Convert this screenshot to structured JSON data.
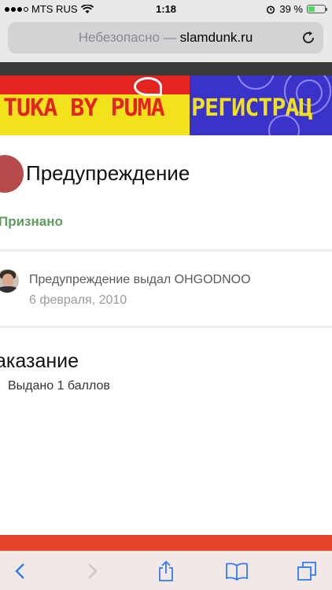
{
  "status_bar": {
    "carrier": "MTS RUS",
    "time": "1:18",
    "battery_percent": "39 %",
    "battery_level": 0.39,
    "battery_color": "#4cd964"
  },
  "browser": {
    "url_insecure_label": "Небезопасно —",
    "url_domain": "slamdunk.ru",
    "reload_icon": "reload-icon",
    "toolbar_icons": [
      "back-arrow-icon",
      "forward-arrow-icon",
      "share-icon",
      "bookmarks-icon",
      "tabs-icon"
    ]
  },
  "banner": {
    "left_text": "TUKA BY PUMA",
    "right_text": "РЕГИСТРАЦ"
  },
  "warning": {
    "title": "Предупреждение",
    "status": "Признано",
    "status_color": "#5f9c5f",
    "issued_by": "Предупреждение выдал OHGODNOO",
    "date": "6 февраля, 2010"
  },
  "penalty": {
    "heading": "аказание",
    "points": "Выдано 1 баллов"
  },
  "colors": {
    "accent_red": "#e32421",
    "accent_blue": "#3b33c9",
    "accent_yellow": "#f2e21b",
    "ios_blue": "#2f7cf6"
  }
}
